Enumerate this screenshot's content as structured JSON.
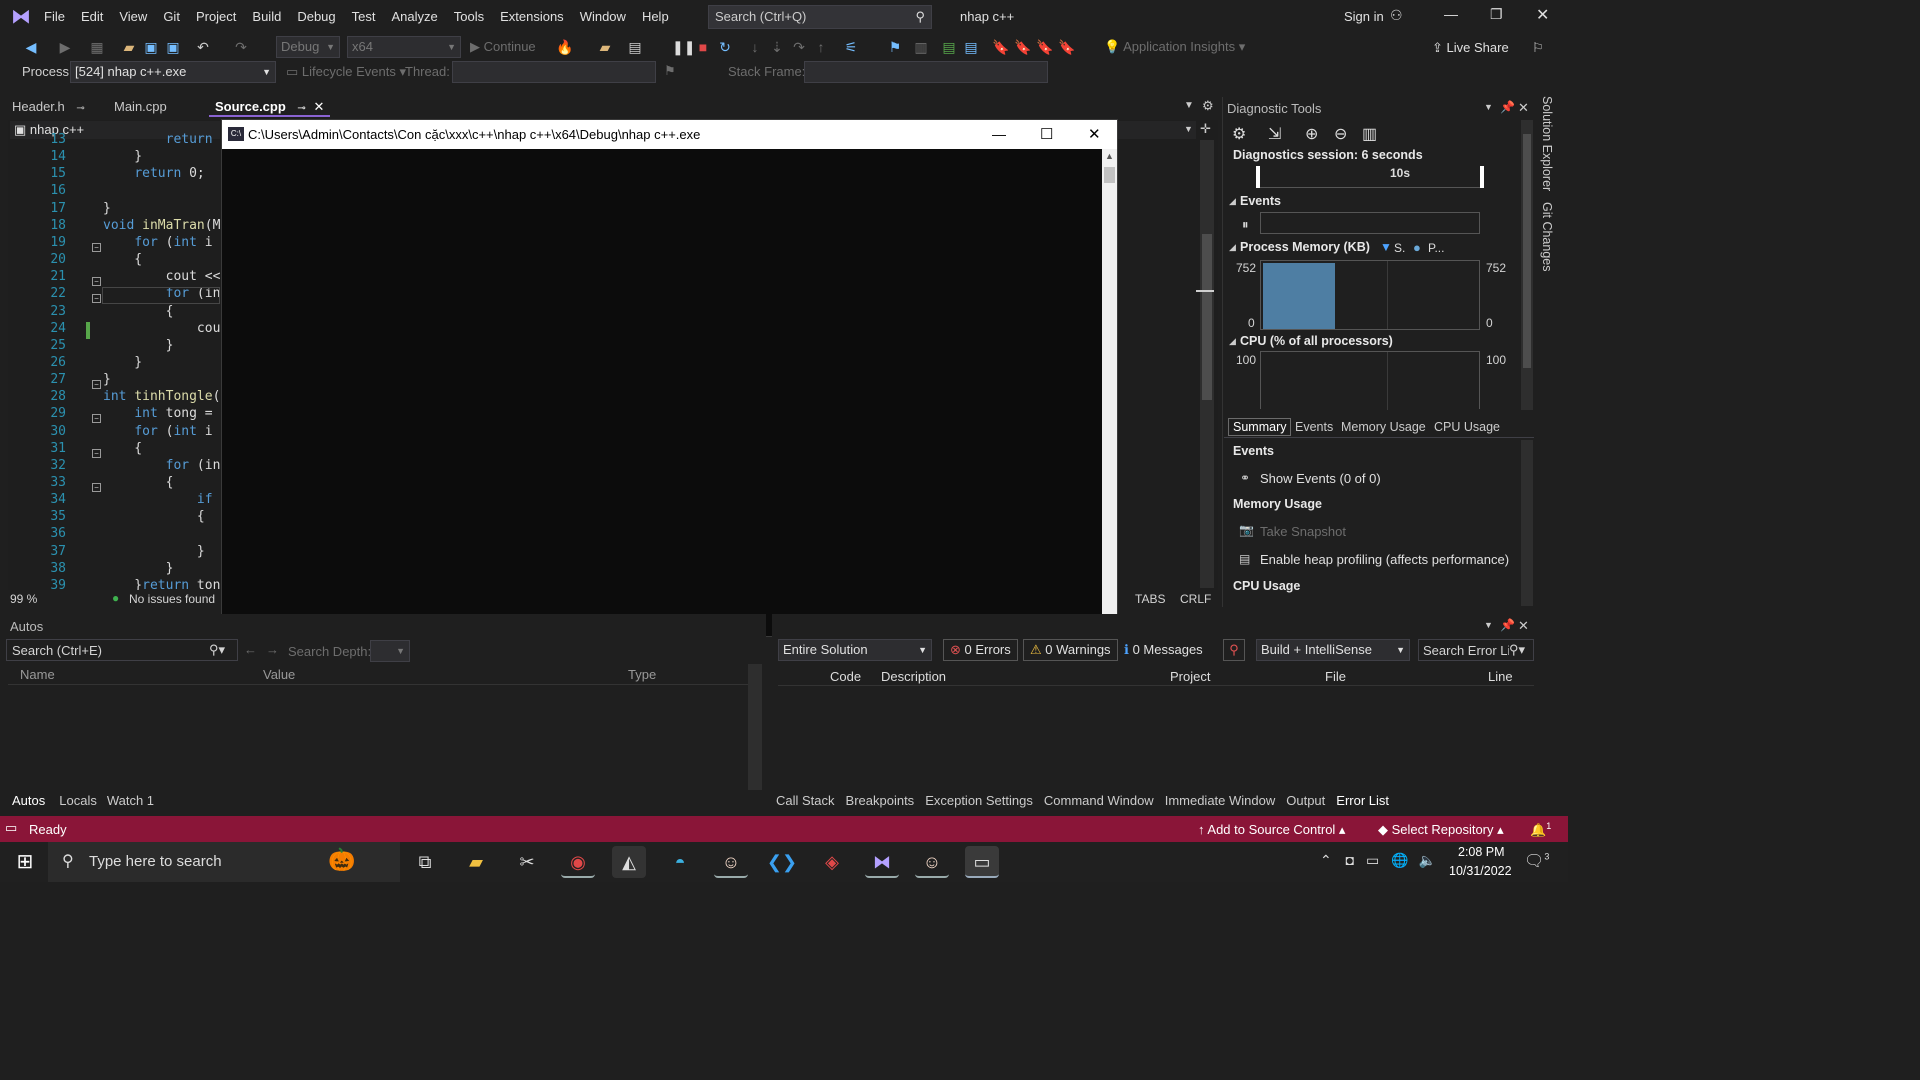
{
  "menu": {
    "items": [
      "File",
      "Edit",
      "View",
      "Git",
      "Project",
      "Build",
      "Debug",
      "Test",
      "Analyze",
      "Tools",
      "Extensions",
      "Window",
      "Help"
    ],
    "search_placeholder": "Search (Ctrl+Q)",
    "solution_name": "nhap c++",
    "sign_in": "Sign in"
  },
  "toolbar": {
    "config": "Debug",
    "platform": "x64",
    "continue": "Continue",
    "app_insights": "Application Insights",
    "live_share": "Live Share"
  },
  "process_bar": {
    "process_label": "Process:",
    "process_value": "[524] nhap c++.exe",
    "lifecycle": "Lifecycle Events",
    "thread_label": "Thread:",
    "stack_frame_label": "Stack Frame:"
  },
  "tabs": [
    {
      "label": "Header.h",
      "active": false
    },
    {
      "label": "Main.cpp",
      "active": false
    },
    {
      "label": "Source.cpp",
      "active": true
    }
  ],
  "editor": {
    "project_dropdown": "nhap c++",
    "zoom": "99 %",
    "issues": "No issues found",
    "tabs_mode": "TABS",
    "line_ending": "CRLF",
    "lines": [
      {
        "n": "13",
        "code": "        return"
      },
      {
        "n": "14",
        "code": "    }"
      },
      {
        "n": "15",
        "code": "    return 0;"
      },
      {
        "n": "16",
        "code": ""
      },
      {
        "n": "17",
        "code": "}"
      },
      {
        "n": "18",
        "code": "void inMaTran(M"
      },
      {
        "n": "19",
        "code": "    for (int i"
      },
      {
        "n": "20",
        "code": "    {"
      },
      {
        "n": "21",
        "code": "        cout <<"
      },
      {
        "n": "22",
        "code": "        for (in"
      },
      {
        "n": "23",
        "code": "        {"
      },
      {
        "n": "24",
        "code": "            cou"
      },
      {
        "n": "25",
        "code": "        }"
      },
      {
        "n": "26",
        "code": "    }"
      },
      {
        "n": "27",
        "code": "}"
      },
      {
        "n": "28",
        "code": "int tinhTongle("
      },
      {
        "n": "29",
        "code": "    int tong ="
      },
      {
        "n": "30",
        "code": "    for (int i"
      },
      {
        "n": "31",
        "code": "    {"
      },
      {
        "n": "32",
        "code": "        for (in"
      },
      {
        "n": "33",
        "code": "        {"
      },
      {
        "n": "34",
        "code": "            if"
      },
      {
        "n": "35",
        "code": "            {"
      },
      {
        "n": "36",
        "code": ""
      },
      {
        "n": "37",
        "code": "            }"
      },
      {
        "n": "38",
        "code": "        }"
      },
      {
        "n": "39",
        "code": "    }return ton"
      }
    ]
  },
  "console": {
    "title": "C:\\Users\\Admin\\Contacts\\Con cặc\\xxx\\c++\\nhap c++\\x64\\Debug\\nhap c++.exe"
  },
  "diagnostics": {
    "title": "Diagnostic Tools",
    "session": "Diagnostics session: 6 seconds",
    "timeline_tick": "10s",
    "events_head": "Events",
    "memory_head": "Process Memory (KB)",
    "memory_legend_s": "S.",
    "memory_legend_p": "P...",
    "memory_max": "752",
    "memory_min": "0",
    "memory_fill_fraction": 1.0,
    "cpu_head": "CPU (% of all processors)",
    "cpu_max": "100",
    "tabs": [
      "Summary",
      "Events",
      "Memory Usage",
      "CPU Usage"
    ],
    "summary": {
      "events": "Events",
      "show_events": "Show Events (0 of 0)",
      "memory_usage": "Memory Usage",
      "take_snapshot": "Take Snapshot",
      "heap_profiling": "Enable heap profiling (affects performance)",
      "cpu_usage": "CPU Usage"
    }
  },
  "side_tabs": [
    "Solution Explorer",
    "Git Changes"
  ],
  "autos": {
    "title": "Autos",
    "search": "Search (Ctrl+E)",
    "search_depth": "Search Depth:",
    "columns": [
      "Name",
      "Value",
      "Type"
    ],
    "bottom_tabs": [
      "Autos",
      "Locals",
      "Watch 1"
    ]
  },
  "error_list": {
    "scope": "Entire Solution",
    "errors": "0 Errors",
    "warnings": "0 Warnings",
    "messages": "0 Messages",
    "build_filter": "Build + IntelliSense",
    "search": "Search Error Li",
    "columns": [
      "Code",
      "Description",
      "Project",
      "File",
      "Line"
    ],
    "bottom_tabs": [
      "Call Stack",
      "Breakpoints",
      "Exception Settings",
      "Command Window",
      "Immediate Window",
      "Output",
      "Error List"
    ]
  },
  "status": {
    "ready": "Ready",
    "source_control": "Add to Source Control",
    "repository": "Select Repository",
    "notifications": "1"
  },
  "taskbar": {
    "search": "Type here to search",
    "time": "2:08 PM",
    "date": "10/31/2022",
    "notif_count": "3"
  },
  "colors": {
    "accent": "#8a63d2",
    "status_bar": "#8a1538",
    "memory_bar": "#4e7ea3"
  }
}
